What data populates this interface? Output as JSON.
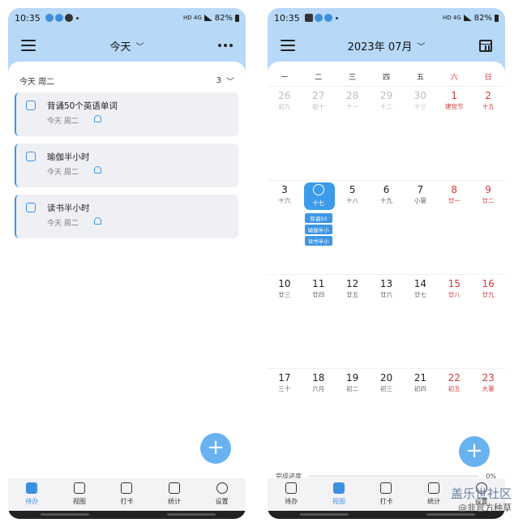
{
  "left": {
    "status": {
      "time": "10:35",
      "network": "HD 4G",
      "battery": "82%"
    },
    "title": "今天",
    "section": {
      "label": "今天 周二",
      "count": "3"
    },
    "tasks": [
      {
        "title": "背诵50个英语单词",
        "sub": "今天 周二"
      },
      {
        "title": "瑜伽半小时",
        "sub": "今天 周二"
      },
      {
        "title": "读书半小时",
        "sub": "今天 周二"
      }
    ],
    "fab": "+",
    "nav": [
      {
        "label": "待办",
        "icon": "todo-icon",
        "active": true
      },
      {
        "label": "视图",
        "icon": "calendar-icon",
        "active": false
      },
      {
        "label": "打卡",
        "icon": "checkin-icon",
        "active": false
      },
      {
        "label": "统计",
        "icon": "stats-icon",
        "active": false
      },
      {
        "label": "设置",
        "icon": "settings-icon",
        "active": false
      }
    ]
  },
  "right": {
    "status": {
      "time": "10:35",
      "network": "HD 4G",
      "battery": "82%"
    },
    "title": "2023年 07月",
    "weekdays": [
      "一",
      "二",
      "三",
      "四",
      "五",
      "六",
      "日"
    ],
    "weeks": [
      [
        {
          "d": "26",
          "l": "初九"
        },
        {
          "d": "27",
          "l": "初十"
        },
        {
          "d": "28",
          "l": "十一"
        },
        {
          "d": "29",
          "l": "十二"
        },
        {
          "d": "30",
          "l": "十三"
        },
        {
          "d": "1",
          "l": "建党节"
        },
        {
          "d": "2",
          "l": "十五"
        }
      ],
      [
        {
          "d": "3",
          "l": "十六"
        },
        {
          "d": "",
          "l": "十七"
        },
        {
          "d": "5",
          "l": "十八"
        },
        {
          "d": "6",
          "l": "十九"
        },
        {
          "d": "7",
          "l": "小暑"
        },
        {
          "d": "8",
          "l": "廿一"
        },
        {
          "d": "9",
          "l": "廿二"
        }
      ],
      [
        {
          "d": "10",
          "l": "廿三"
        },
        {
          "d": "11",
          "l": "廿四"
        },
        {
          "d": "12",
          "l": "廿五"
        },
        {
          "d": "13",
          "l": "廿六"
        },
        {
          "d": "14",
          "l": "廿七"
        },
        {
          "d": "15",
          "l": "廿八"
        },
        {
          "d": "16",
          "l": "廿九"
        }
      ],
      [
        {
          "d": "17",
          "l": "三十"
        },
        {
          "d": "18",
          "l": "六月"
        },
        {
          "d": "19",
          "l": "初二"
        },
        {
          "d": "20",
          "l": "初三"
        },
        {
          "d": "21",
          "l": "初四"
        },
        {
          "d": "22",
          "l": "初五"
        },
        {
          "d": "23",
          "l": "大暑"
        }
      ]
    ],
    "events": [
      "背诵50",
      "瑜伽半小",
      "读书半小"
    ],
    "progress": {
      "label": "完成进度",
      "value": "0%",
      "fraction": 0
    },
    "fab": "+",
    "nav": [
      {
        "label": "待办",
        "icon": "todo-icon",
        "active": false
      },
      {
        "label": "视图",
        "icon": "calendar-icon",
        "active": true
      },
      {
        "label": "打卡",
        "icon": "checkin-icon",
        "active": false
      },
      {
        "label": "统计",
        "icon": "stats-icon",
        "active": false
      },
      {
        "label": "设置",
        "icon": "settings-icon",
        "active": false
      }
    ]
  },
  "watermark": {
    "line1": "盖乐世社区",
    "line2": "@非官方种草"
  },
  "colors": {
    "accent": "#3d96e6",
    "header": "#b7d8f7",
    "weekend": "#d23a3a"
  }
}
